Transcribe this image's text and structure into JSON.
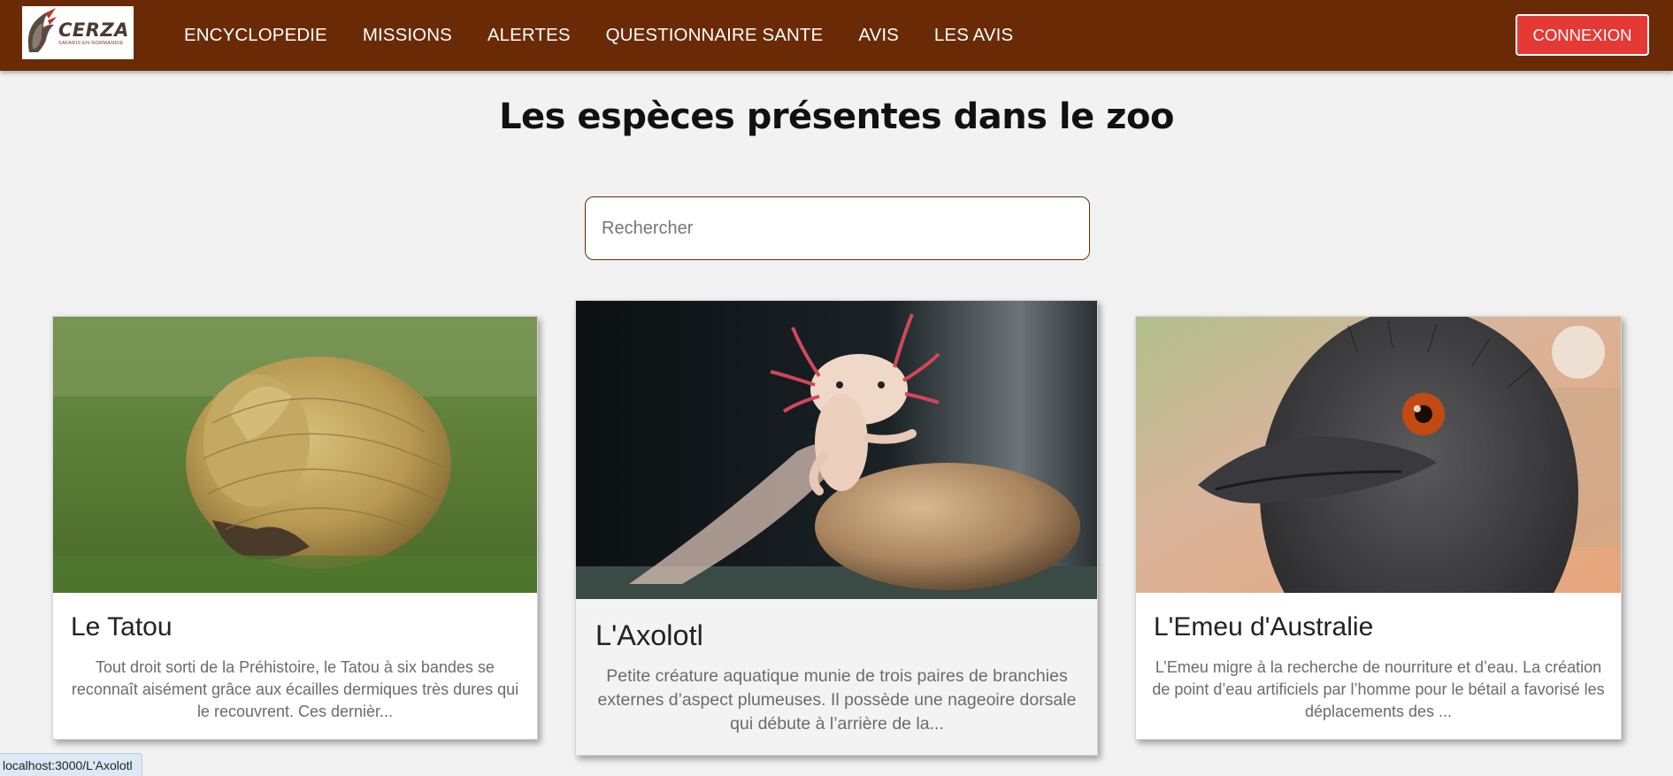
{
  "brand": {
    "name": "CERZA",
    "tagline": "SAFARIS EN NORMANDIE"
  },
  "nav": {
    "items": [
      {
        "label": "ENCYCLOPEDIE"
      },
      {
        "label": "MISSIONS"
      },
      {
        "label": "ALERTES"
      },
      {
        "label": "QUESTIONNAIRE SANTE"
      },
      {
        "label": "AVIS"
      },
      {
        "label": "LES AVIS"
      }
    ],
    "login_label": "CONNEXION"
  },
  "page": {
    "title": "Les espèces présentes dans le zoo"
  },
  "search": {
    "placeholder": "Rechercher",
    "value": ""
  },
  "cards": [
    {
      "title": "Le Tatou",
      "description": "Tout droit sorti de la Préhistoire, le Tatou à six bandes se reconnaît aisément grâce aux écailles dermiques très dures qui le recouvrent. Ces dernièr...",
      "image_icon": "armadillo-photo"
    },
    {
      "title": "L'Axolotl",
      "description": "Petite créature aquatique munie de trois paires de branchies externes d’aspect plumeuses. Il possède une nageoire dorsale qui débute à l’arrière de la...",
      "image_icon": "axolotl-photo"
    },
    {
      "title": "L'Emeu d'Australie",
      "description": "L’Emeu migre à la recherche de nourriture et d’eau. La création de point d’eau artificiels par l’homme pour le bétail a favorisé les déplacements des ...",
      "image_icon": "emu-photo"
    }
  ],
  "status_bar": {
    "url": "localhost:3000/L'Axolotl"
  },
  "colors": {
    "navbar": "#6a2a05",
    "login_button": "#e53935",
    "page_background": "#f2f2f2",
    "search_border": "#6a2a05"
  }
}
